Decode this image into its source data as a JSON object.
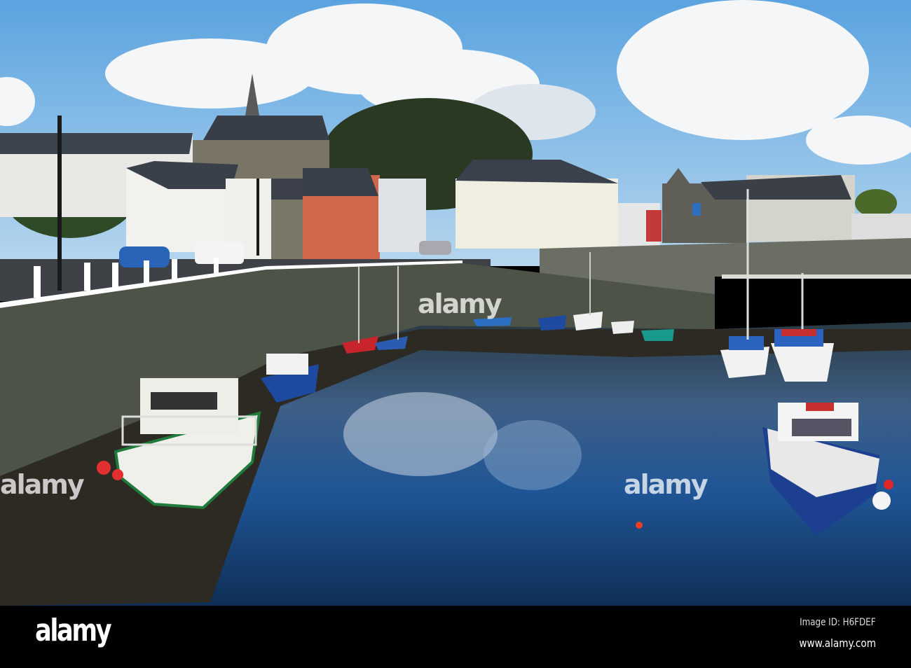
{
  "watermark": {
    "text": "alamy"
  },
  "footer": {
    "logo": "alamy",
    "image_id": "Image ID: H6FDEF",
    "website": "www.alamy.com"
  },
  "colors": {
    "sky": "#6fb1e6",
    "water": "#1d4f86",
    "wall": "#4d5346"
  }
}
